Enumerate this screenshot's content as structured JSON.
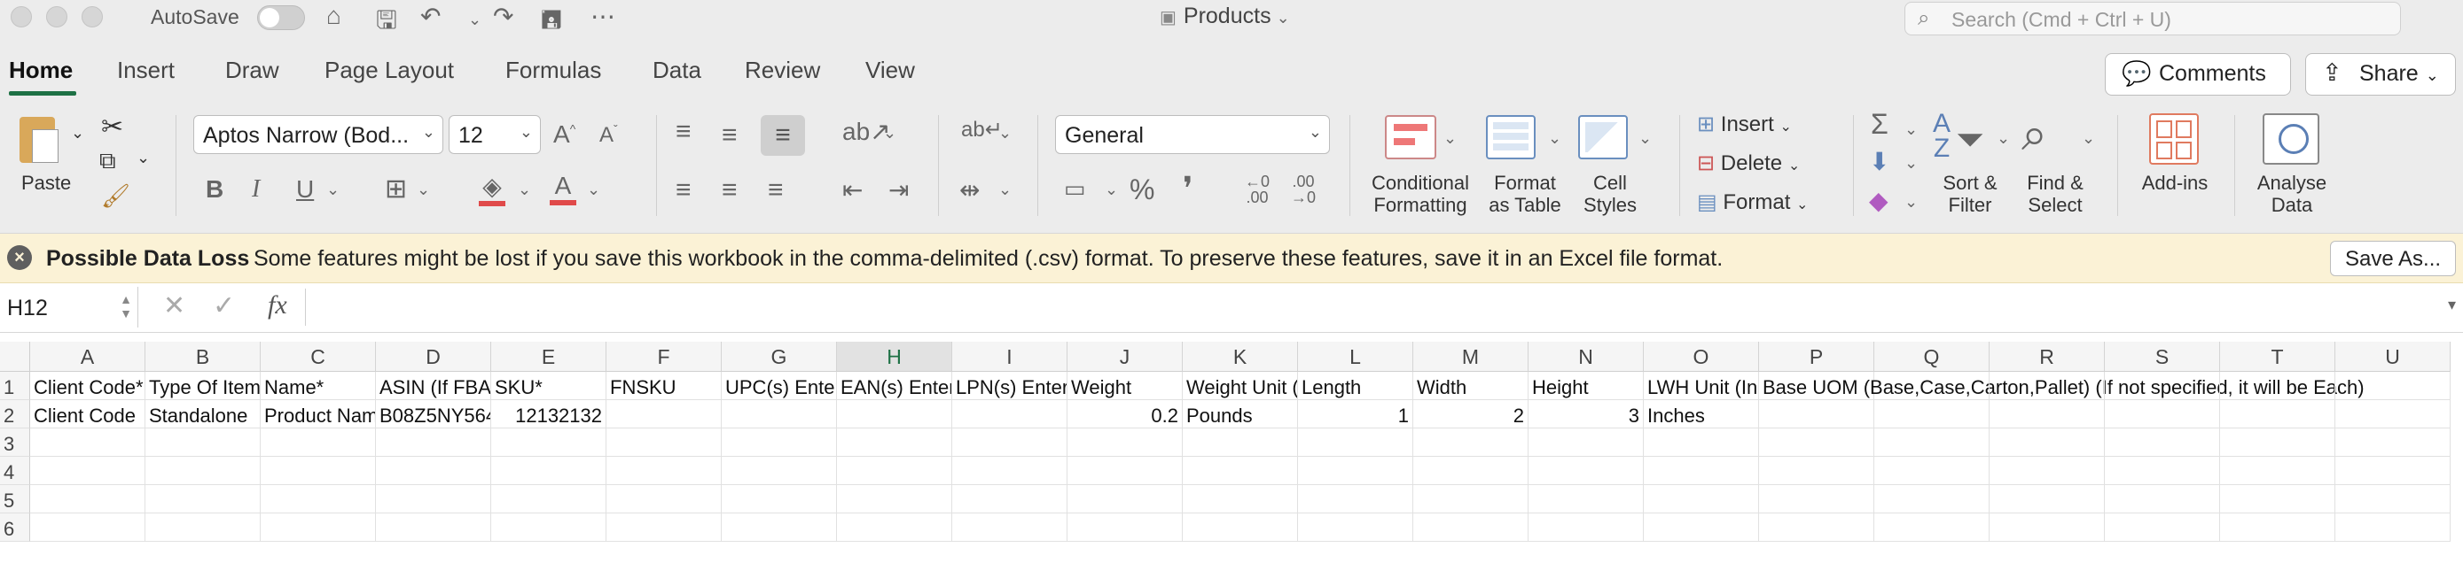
{
  "titlebar": {
    "autosave_label": "AutoSave",
    "doc_title": "Products",
    "search_placeholder": "Search (Cmd + Ctrl + U)"
  },
  "tabs": [
    "Home",
    "Insert",
    "Draw",
    "Page Layout",
    "Formulas",
    "Data",
    "Review",
    "View"
  ],
  "tab_buttons": {
    "comments": "Comments",
    "share": "Share"
  },
  "ribbon": {
    "paste": "Paste",
    "font_name": "Aptos Narrow (Bod...",
    "font_size": "12",
    "bold": "B",
    "italic": "I",
    "underline": "U",
    "number_format": "General",
    "percent": "%",
    "comma": "❜",
    "conditional_formatting": [
      "Conditional",
      "Formatting"
    ],
    "format_as_table": [
      "Format",
      "as Table"
    ],
    "cell_styles": [
      "Cell",
      "Styles"
    ],
    "insert": "Insert",
    "delete": "Delete",
    "format": "Format",
    "sort_filter": [
      "Sort &",
      "Filter"
    ],
    "find_select": [
      "Find &",
      "Select"
    ],
    "add_ins": "Add-ins",
    "analyse_data": [
      "Analyse",
      "Data"
    ]
  },
  "message_bar": {
    "title": "Possible Data Loss",
    "text": "Some features might be lost if you save this workbook in the comma-delimited (.csv) format. To preserve these features, save it in an Excel file format.",
    "button": "Save As..."
  },
  "formula_bar": {
    "name_box": "H12",
    "fx": "fx",
    "value": ""
  },
  "sheet": {
    "selected_column": "H",
    "columns": [
      "A",
      "B",
      "C",
      "D",
      "E",
      "F",
      "G",
      "H",
      "I",
      "J",
      "K",
      "L",
      "M",
      "N",
      "O",
      "P",
      "Q",
      "R",
      "S",
      "T",
      "U"
    ],
    "rows": [
      "1",
      "2",
      "3",
      "4",
      "5",
      "6"
    ],
    "row1": [
      "Client Code*",
      "Type Of Item",
      "Name*",
      "ASIN (If FBA i",
      "SKU*",
      "FNSKU",
      "UPC(s) Enter",
      "EAN(s) Enter",
      "LPN(s) Enter",
      "Weight",
      "Weight Unit (",
      "Length",
      "Width",
      "Height",
      "LWH Unit (In",
      "Base UOM (Base,Case,Carton,Pallet) (If not specified, it will be Each)",
      "",
      "",
      "",
      "",
      ""
    ],
    "row2": [
      "Client Code",
      "Standalone",
      "Product Nam",
      "B08Z5NY564",
      "12132132",
      "",
      "",
      "",
      "",
      "0.2",
      "Pounds",
      "1",
      "2",
      "3",
      "Inches",
      "",
      "",
      "",
      "",
      "",
      ""
    ]
  }
}
